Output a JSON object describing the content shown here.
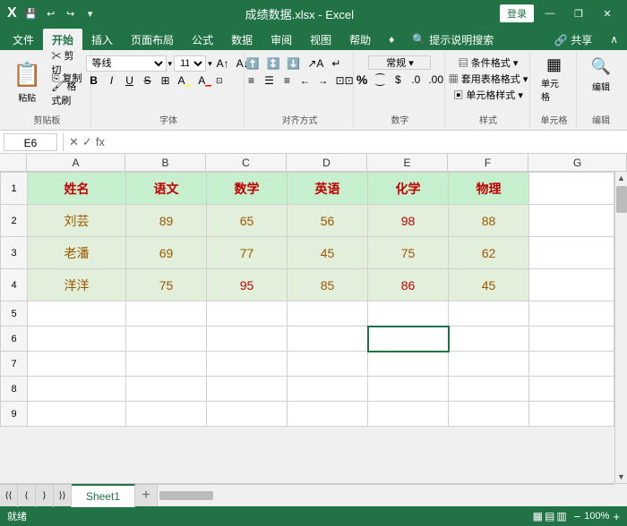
{
  "titlebar": {
    "filename": "成绩数据.xlsx - Excel",
    "login_label": "登录",
    "minimize": "—",
    "restore": "❐",
    "close": "✕"
  },
  "quickaccess": {
    "save": "💾",
    "undo": "↩",
    "redo": "↪",
    "dropdown": "▾"
  },
  "ribbon": {
    "tabs": [
      "文件",
      "开始",
      "插入",
      "页面布局",
      "公式",
      "数据",
      "审阅",
      "视图",
      "帮助",
      "♦",
      "提示说明搜索"
    ],
    "active_tab": "开始",
    "groups": {
      "clipboard": {
        "label": "剪贴板",
        "paste": "粘贴",
        "cut": "✂",
        "copy": "⎘",
        "format_painter": "🖌"
      },
      "font": {
        "label": "字体",
        "font_name": "等线",
        "font_size": "11",
        "bold": "B",
        "italic": "I",
        "underline": "U",
        "strikethrough": "S",
        "border": "⊞",
        "fill": "A",
        "color": "A"
      },
      "alignment": {
        "label": "对齐方式"
      },
      "number": {
        "label": "数字",
        "format": "%"
      },
      "styles": {
        "label": "样式",
        "conditional": "条件格式 ▾",
        "table": "套用表格格式 ▾",
        "cell": "单元格样式 ▾"
      },
      "cells": {
        "label": "单元格",
        "cell_btn": "单元格"
      },
      "editing": {
        "label": "编辑"
      }
    }
  },
  "formulabar": {
    "cell_ref": "E6",
    "cancel": "✕",
    "confirm": "✓",
    "fx": "fx",
    "value": ""
  },
  "columns": {
    "headers": [
      "A",
      "B",
      "C",
      "D",
      "E",
      "F",
      "G"
    ],
    "widths": [
      110,
      90,
      90,
      90,
      90,
      90,
      80
    ]
  },
  "rows": {
    "numbers": [
      1,
      2,
      3,
      4,
      5,
      6,
      7,
      8,
      9
    ],
    "height": 36
  },
  "table": {
    "headers": [
      "姓名",
      "语文",
      "数学",
      "英语",
      "化学",
      "物理"
    ],
    "data": [
      [
        "刘芸",
        "89",
        "65",
        "56",
        "98",
        "88"
      ],
      [
        "老潘",
        "69",
        "77",
        "45",
        "75",
        "62"
      ],
      [
        "洋洋",
        "75",
        "95",
        "85",
        "86",
        "45"
      ]
    ]
  },
  "sheet_tabs": {
    "sheets": [
      "Sheet1"
    ],
    "active": "Sheet1",
    "add_label": "+"
  },
  "statusbar": {
    "ready": "就绪",
    "zoom": "100%",
    "view_normal": "▦",
    "view_layout": "▤",
    "view_page": "▥"
  }
}
